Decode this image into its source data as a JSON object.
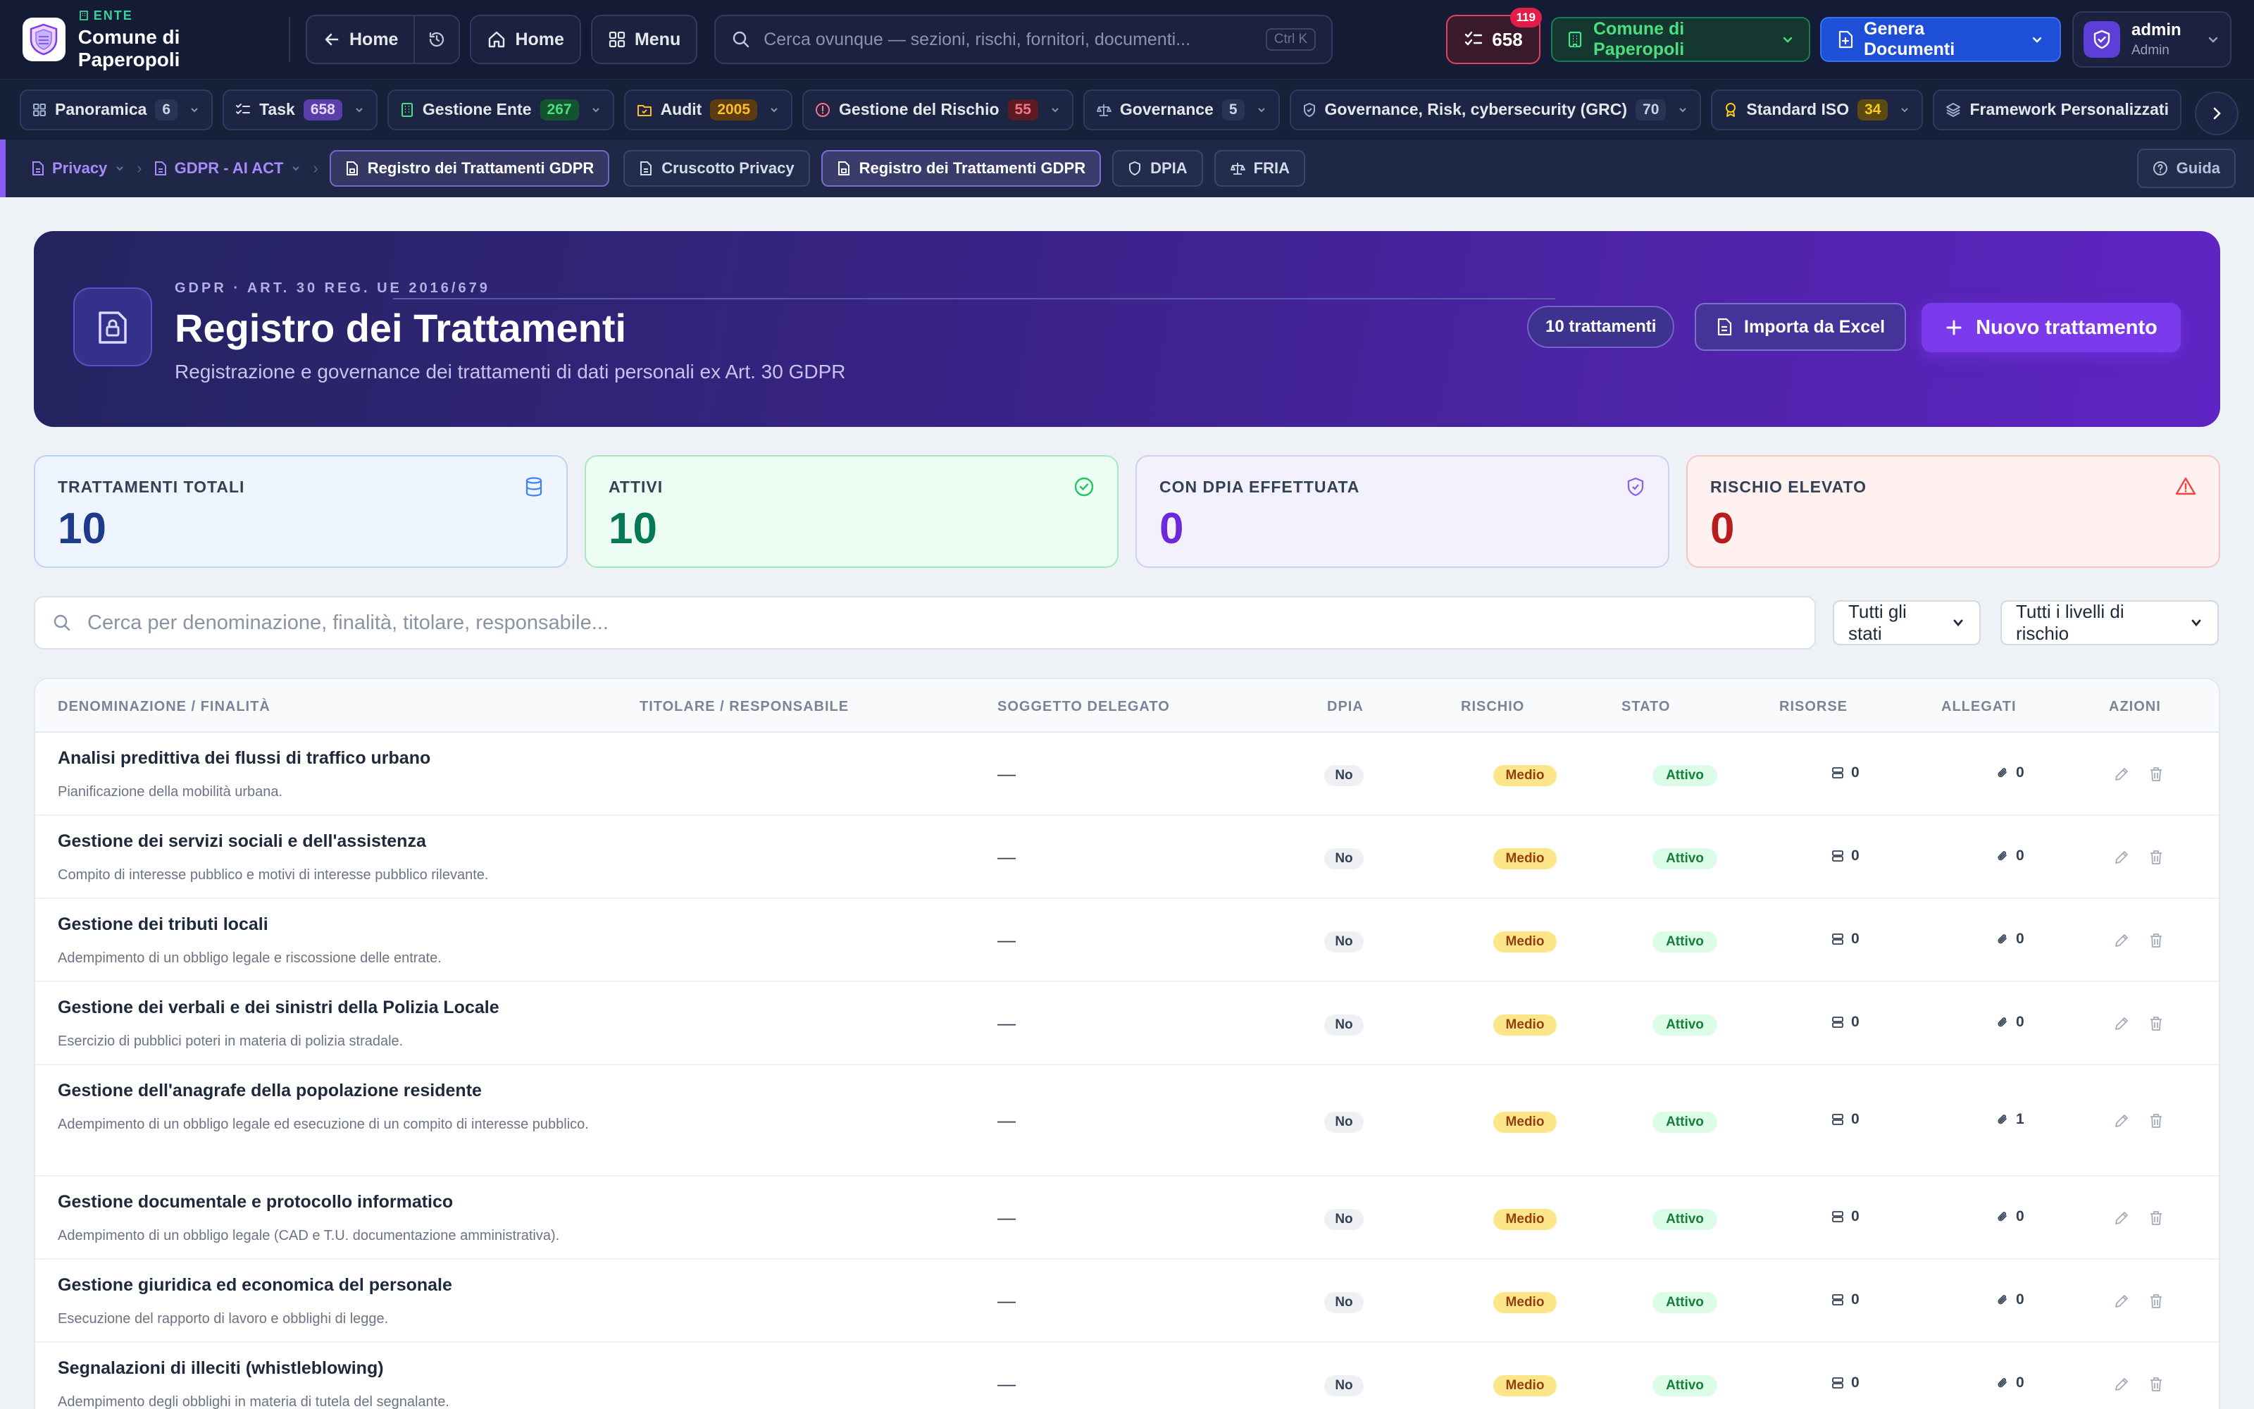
{
  "header": {
    "org_kicker": "ENTE",
    "org_name": "Comune di Paperopoli",
    "back_label": "Home",
    "home_label": "Home",
    "menu_label": "Menu",
    "search_placeholder": "Cerca ovunque — sezioni, rischi, fornitori, documenti...",
    "search_shortcut": "Ctrl K",
    "tasks_count": "658",
    "tasks_badge": "119",
    "org_selector": "Comune di Paperopoli",
    "generate_label": "Genera Documenti",
    "user_name": "admin",
    "user_role": "Admin"
  },
  "modules": [
    {
      "label": "Panoramica",
      "count": "6",
      "icon": "grid-icon",
      "count_bg": "#2a3354",
      "count_fg": "#cbd5e1"
    },
    {
      "label": "Task",
      "count": "658",
      "icon": "checklist-icon",
      "count_bg": "#5b3fa8",
      "count_fg": "#e9d5ff"
    },
    {
      "label": "Gestione Ente",
      "count": "267",
      "icon": "building-icon",
      "count_bg": "#14532d",
      "count_fg": "#4ade80"
    },
    {
      "label": "Audit",
      "count": "2005",
      "icon": "folder-check-icon",
      "count_bg": "#5c3a12",
      "count_fg": "#fbbf24"
    },
    {
      "label": "Gestione del Rischio",
      "count": "55",
      "icon": "alert-circle-icon",
      "count_bg": "#5c1a22",
      "count_fg": "#fb7185"
    },
    {
      "label": "Governance",
      "count": "5",
      "icon": "scale-icon",
      "count_bg": "#2a3354",
      "count_fg": "#cbd5e1"
    },
    {
      "label": "Governance, Risk, cybersecurity (GRC)",
      "count": "70",
      "icon": "shield-check-icon",
      "count_bg": "#2a3354",
      "count_fg": "#cbd5e1"
    },
    {
      "label": "Standard ISO",
      "count": "34",
      "icon": "award-icon",
      "count_bg": "#5c4a12",
      "count_fg": "#facc15"
    },
    {
      "label": "Framework Personalizzati",
      "count": "",
      "icon": "layers-icon",
      "count_bg": "#2a3354",
      "count_fg": "#cbd5e1"
    }
  ],
  "subnav": {
    "crumbs": [
      "Privacy",
      "GDPR - AI ACT"
    ],
    "tabs": [
      "Registro dei Trattamenti GDPR",
      "Cruscotto Privacy",
      "Registro dei Trattamenti GDPR",
      "DPIA",
      "FRIA"
    ],
    "guide": "Guida"
  },
  "hero": {
    "kicker": "GDPR · ART. 30 REG. UE 2016/679",
    "title": "Registro dei Trattamenti",
    "subtitle": "Registrazione e governance dei trattamenti di dati personali ex Art. 30 GDPR",
    "count_badge": "10 trattamenti",
    "import_label": "Importa da Excel",
    "new_label": "Nuovo trattamento"
  },
  "kpis": [
    {
      "label": "TRATTAMENTI TOTALI",
      "value": "10",
      "icon": "database-icon",
      "bg": "#eef5ff",
      "border": "#bcd3f5",
      "label_color": "#334155",
      "value_color": "#1e3a8a"
    },
    {
      "label": "ATTIVI",
      "value": "10",
      "icon": "check-circle-icon",
      "bg": "#ecfdf3",
      "border": "#a7e8c3",
      "label_color": "#334155",
      "value_color": "#047857"
    },
    {
      "label": "CON DPIA EFFETTUATA",
      "value": "0",
      "icon": "shield-icon",
      "bg": "#f3f1fd",
      "border": "#d4cdf3",
      "label_color": "#334155",
      "value_color": "#6d28d9"
    },
    {
      "label": "RISCHIO ELEVATO",
      "value": "0",
      "icon": "warning-icon",
      "bg": "#fff1ef",
      "border": "#f5c6c0",
      "label_color": "#334155",
      "value_color": "#b91c1c"
    }
  ],
  "filters": {
    "search_placeholder": "Cerca per denominazione, finalità, titolare, responsabile...",
    "status_select": "Tutti gli stati",
    "risk_select": "Tutti i livelli di rischio"
  },
  "table": {
    "columns": [
      "DENOMINAZIONE / FINALITÀ",
      "TITOLARE / RESPONSABILE",
      "SOGGETTO DELEGATO",
      "DPIA",
      "RISCHIO",
      "STATO",
      "RISORSE",
      "ALLEGATI",
      "AZIONI"
    ],
    "rows": [
      {
        "name": "Analisi predittiva dei flussi di traffico urbano",
        "desc": "Pianificazione della mobilità urbana.",
        "delegate": "—",
        "dpia": "No",
        "risk": "Medio",
        "status": "Attivo",
        "resources": "0",
        "attachments": "0"
      },
      {
        "name": "Gestione dei servizi sociali e dell'assistenza",
        "desc": "Compito di interesse pubblico e motivi di interesse pubblico rilevante.",
        "delegate": "—",
        "dpia": "No",
        "risk": "Medio",
        "status": "Attivo",
        "resources": "0",
        "attachments": "0"
      },
      {
        "name": "Gestione dei tributi locali",
        "desc": "Adempimento di un obbligo legale e riscossione delle entrate.",
        "delegate": "—",
        "dpia": "No",
        "risk": "Medio",
        "status": "Attivo",
        "resources": "0",
        "attachments": "0"
      },
      {
        "name": "Gestione dei verbali e dei sinistri della Polizia Locale",
        "desc": "Esercizio di pubblici poteri in materia di polizia stradale.",
        "delegate": "—",
        "dpia": "No",
        "risk": "Medio",
        "status": "Attivo",
        "resources": "0",
        "attachments": "0"
      },
      {
        "name": "Gestione dell'anagrafe della popolazione residente",
        "desc": "Adempimento di un obbligo legale ed esecuzione di un compito di interesse pubblico.",
        "delegate": "—",
        "dpia": "No",
        "risk": "Medio",
        "status": "Attivo",
        "resources": "0",
        "attachments": "1"
      },
      {
        "name": "Gestione documentale e protocollo informatico",
        "desc": "Adempimento di un obbligo legale (CAD e T.U. documentazione amministrativa).",
        "delegate": "—",
        "dpia": "No",
        "risk": "Medio",
        "status": "Attivo",
        "resources": "0",
        "attachments": "0"
      },
      {
        "name": "Gestione giuridica ed economica del personale",
        "desc": "Esecuzione del rapporto di lavoro e obblighi di legge.",
        "delegate": "—",
        "dpia": "No",
        "risk": "Medio",
        "status": "Attivo",
        "resources": "0",
        "attachments": "0"
      },
      {
        "name": "Segnalazioni di illeciti (whistleblowing)",
        "desc": "Adempimento degli obblighi in materia di tutela del segnalante.",
        "delegate": "—",
        "dpia": "No",
        "risk": "Medio",
        "status": "Attivo",
        "resources": "0",
        "attachments": "0"
      }
    ]
  }
}
